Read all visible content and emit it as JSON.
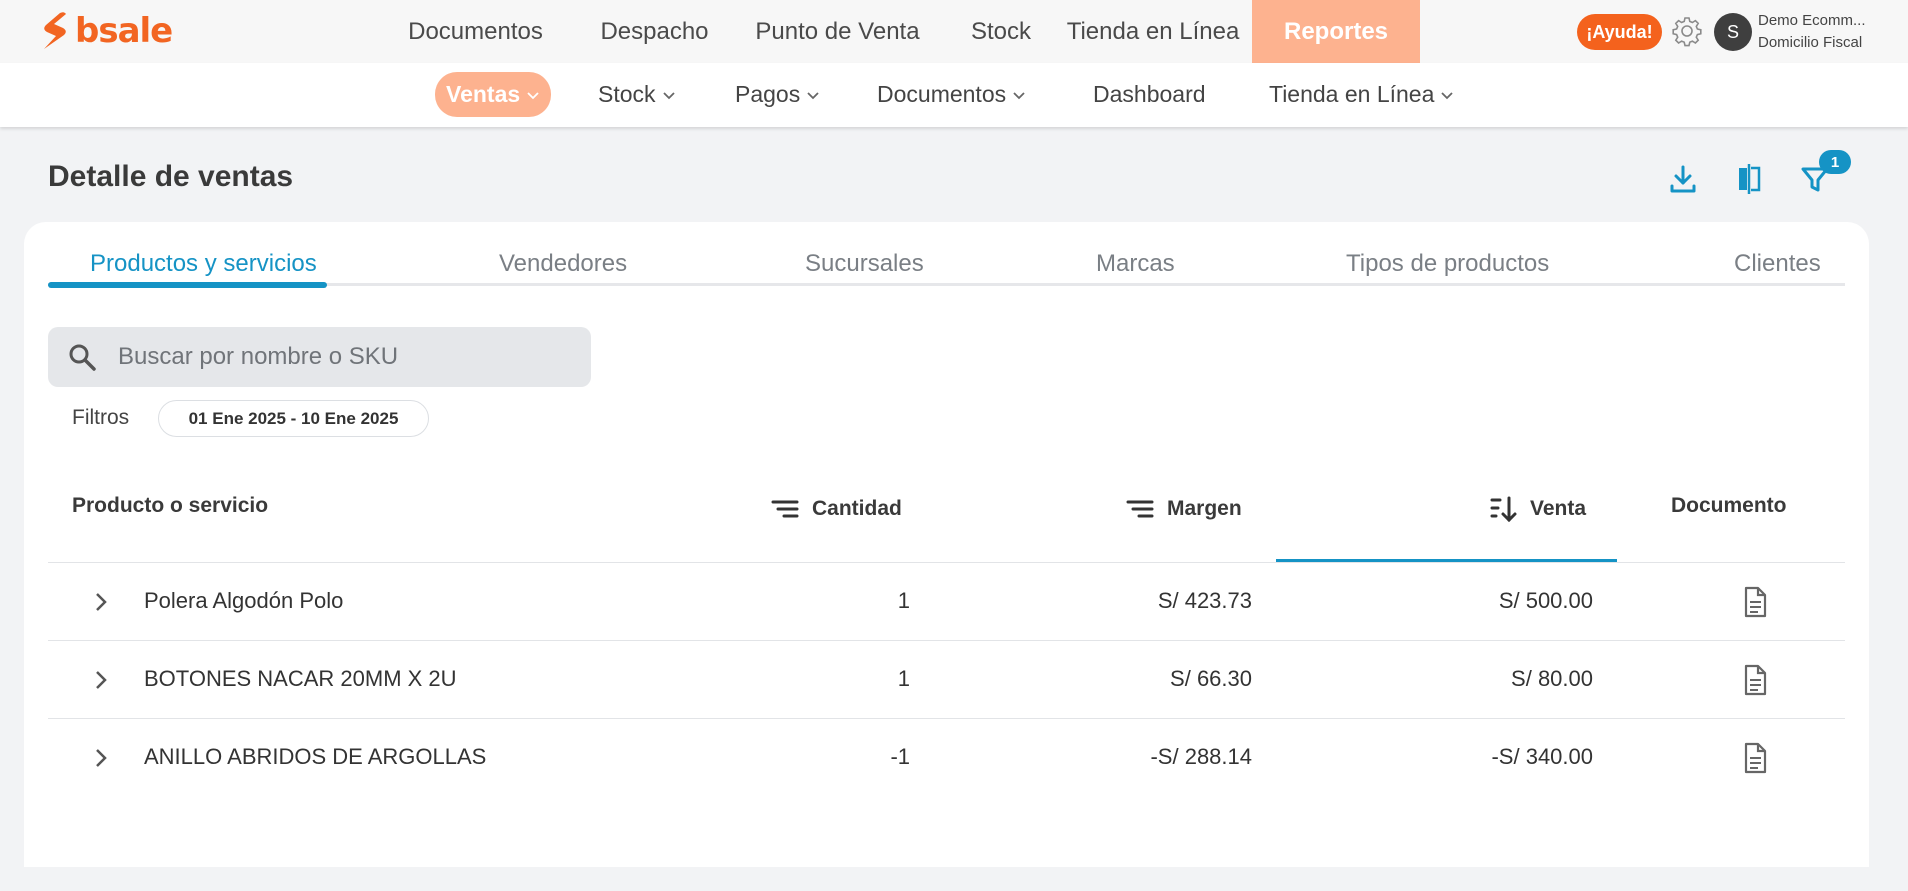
{
  "brand": {
    "name": "bsale",
    "color": "#f26522"
  },
  "main_nav": [
    {
      "label": "Documentos",
      "active": false
    },
    {
      "label": "Despacho",
      "active": false
    },
    {
      "label": "Punto de Venta",
      "active": false
    },
    {
      "label": "Stock",
      "active": false
    },
    {
      "label": "Tienda en Línea",
      "active": false
    },
    {
      "label": "Reportes",
      "active": true
    }
  ],
  "top_right": {
    "help_label": "¡Ayuda!",
    "avatar_initial": "S",
    "account_name": "Demo Ecomm...",
    "account_sub": "Domicilio Fiscal"
  },
  "sub_nav": [
    {
      "label": "Ventas",
      "dropdown": true,
      "active": true
    },
    {
      "label": "Stock",
      "dropdown": true
    },
    {
      "label": "Pagos",
      "dropdown": true
    },
    {
      "label": "Documentos",
      "dropdown": true
    },
    {
      "label": "Dashboard",
      "dropdown": false
    },
    {
      "label": "Tienda en Línea",
      "dropdown": true
    }
  ],
  "page": {
    "title": "Detalle de ventas",
    "filter_count": "1",
    "tools": [
      "download-icon",
      "compare-columns-icon",
      "filter-icon"
    ]
  },
  "tabs": [
    {
      "label": "Productos y servicios",
      "active": true
    },
    {
      "label": "Vendedores"
    },
    {
      "label": "Sucursales"
    },
    {
      "label": "Marcas"
    },
    {
      "label": "Tipos de productos"
    },
    {
      "label": "Clientes"
    }
  ],
  "search": {
    "placeholder": "Buscar por nombre o SKU"
  },
  "filters": {
    "label": "Filtros",
    "date_range": "01 Ene 2025 - 10 Ene 2025"
  },
  "table": {
    "columns": {
      "product": "Producto o servicio",
      "quantity": "Cantidad",
      "margin": "Margen",
      "sale": "Venta",
      "document": "Documento"
    },
    "sorted_by": "Venta",
    "rows": [
      {
        "product": "Polera Algodón Polo",
        "quantity": "1",
        "margin": "S/ 423.73",
        "sale": "S/ 500.00"
      },
      {
        "product": "BOTONES NACAR 20MM X 2U",
        "quantity": "1",
        "margin": "S/ 66.30",
        "sale": "S/ 80.00"
      },
      {
        "product": "ANILLO ABRIDOS DE ARGOLLAS",
        "quantity": "-1",
        "margin": "-S/ 288.14",
        "sale": "-S/ 340.00"
      }
    ]
  },
  "colors": {
    "accent": "#1593c5",
    "nav_active": "#fdb28f",
    "help": "#f4621d"
  }
}
